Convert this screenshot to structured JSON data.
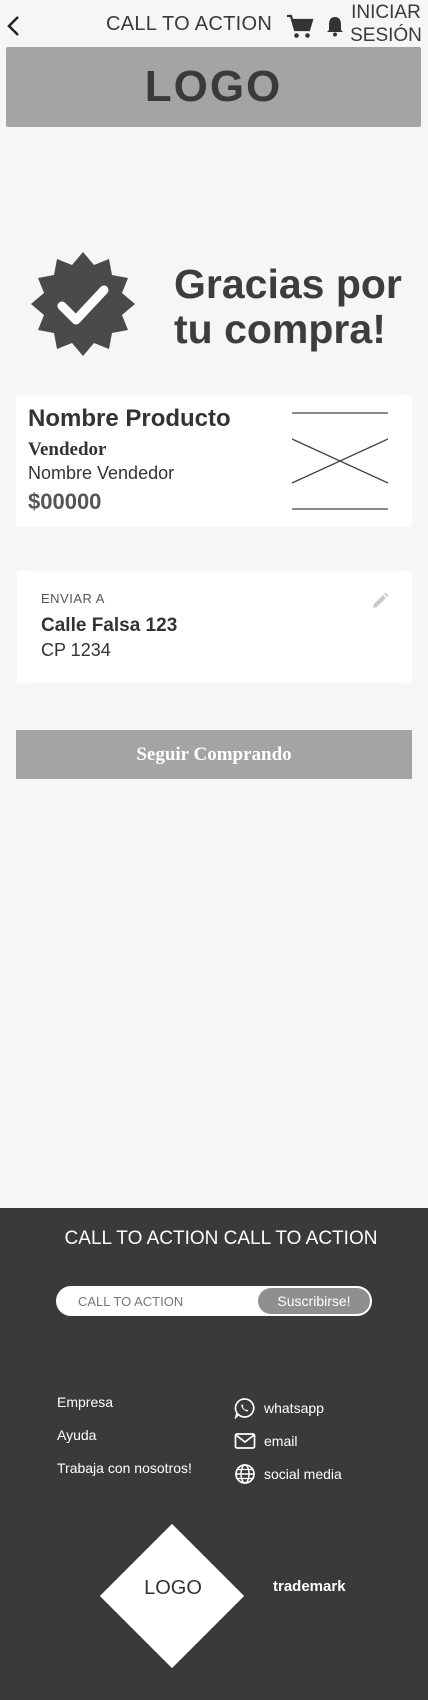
{
  "header": {
    "cta": "CALL TO ACTION",
    "login": "INICIAR SESIÓN",
    "logo": "LOGO"
  },
  "confirmation": {
    "title_line1": "Gracias por",
    "title_line2": "tu compra!"
  },
  "product": {
    "name": "Nombre Producto",
    "vendor_label": "Vendedor",
    "vendor_name": "Nombre Vendedor",
    "price": "$00000"
  },
  "shipping": {
    "label": "ENVIAR A",
    "street": "Calle Falsa 123",
    "postal": "CP 1234"
  },
  "actions": {
    "continue_label": "Seguir Comprando"
  },
  "footer": {
    "cta": "CALL TO ACTION CALL TO ACTION",
    "subscribe_placeholder": "CALL TO ACTION",
    "subscribe_button": "Suscribirse!",
    "links": [
      "Empresa",
      "Ayuda",
      "Trabaja con nosotros!"
    ],
    "social": [
      {
        "label": "whatsapp",
        "icon": "whatsapp-icon"
      },
      {
        "label": "email",
        "icon": "email-icon"
      },
      {
        "label": "social media",
        "icon": "globe-icon"
      }
    ],
    "logo": "LOGO",
    "trademark": "trademark"
  },
  "colors": {
    "background": "#f7f5f6",
    "gray": "#a4a4a4",
    "dark": "#3b393a",
    "text": "#333333"
  }
}
